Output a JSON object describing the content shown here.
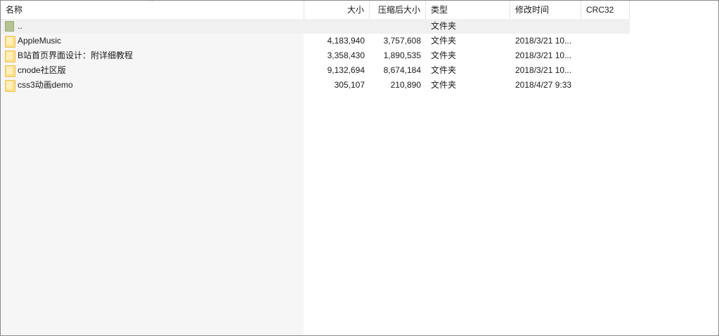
{
  "header": {
    "name": "名称",
    "size": "大小",
    "packed": "压缩后大小",
    "type": "类型",
    "modified": "修改时间",
    "crc": "CRC32",
    "sort_indicator": "^"
  },
  "rows": [
    {
      "name": "..",
      "size": "",
      "packed": "",
      "type": "文件夹",
      "modified": "",
      "crc": "",
      "icon": "parent-folder-icon"
    },
    {
      "name": "AppleMusic",
      "size": "4,183,940",
      "packed": "3,757,608",
      "type": "文件夹",
      "modified": "2018/3/21 10...",
      "crc": "",
      "icon": "folder-icon"
    },
    {
      "name": "B站首页界面设计：附详细教程",
      "size": "3,358,430",
      "packed": "1,890,535",
      "type": "文件夹",
      "modified": "2018/3/21 10...",
      "crc": "",
      "icon": "folder-icon"
    },
    {
      "name": "cnode社区版",
      "size": "9,132,694",
      "packed": "8,674,184",
      "type": "文件夹",
      "modified": "2018/3/21 10...",
      "crc": "",
      "icon": "folder-icon"
    },
    {
      "name": "css3动画demo",
      "size": "305,107",
      "packed": "210,890",
      "type": "文件夹",
      "modified": "2018/4/27 9:33",
      "crc": "",
      "icon": "folder-icon"
    }
  ],
  "colors": {
    "folder": "#ffe08a",
    "parent_folder": "#b6c392",
    "name_column_bg": "#f6f6f6"
  }
}
